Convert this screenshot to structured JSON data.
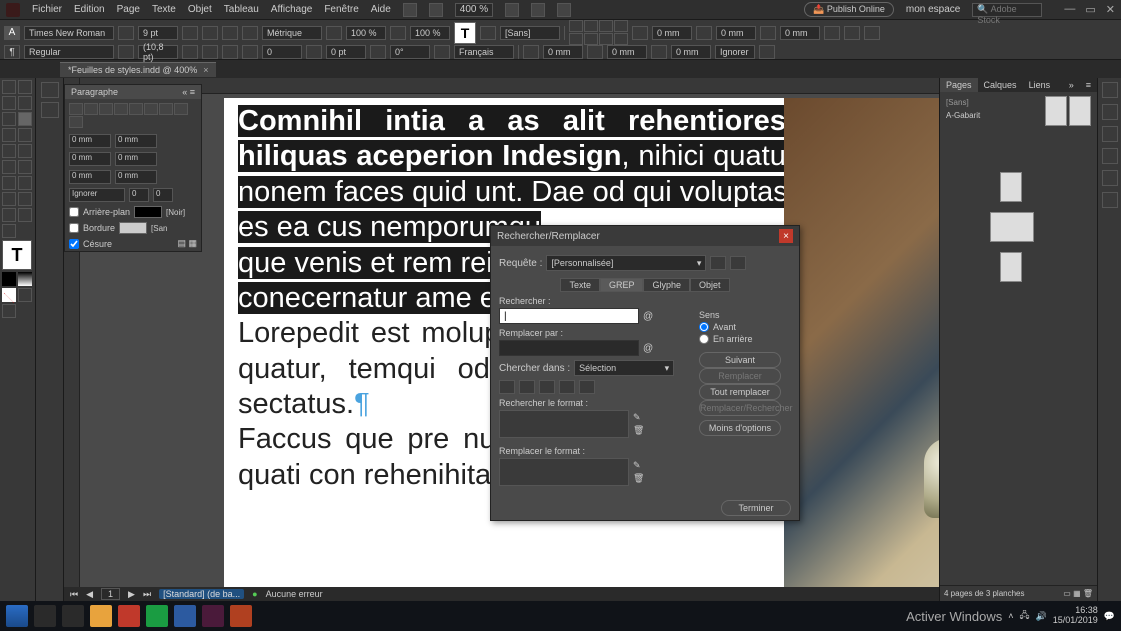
{
  "menu": {
    "items": [
      "Fichier",
      "Edition",
      "Page",
      "Texte",
      "Objet",
      "Tableau",
      "Affichage",
      "Fenêtre",
      "Aide"
    ],
    "zoom": "400 %",
    "publish": "Publish Online",
    "workspace": "mon espace",
    "stock_placeholder": "Adobe Stock"
  },
  "ctrl": {
    "font_family": "Times New Roman",
    "font_size": "9 pt",
    "leading": "(10,8 pt)",
    "tracking": "Métrique",
    "kerning_pct_1": "100 %",
    "kerning_pct_2": "100 %",
    "baseline": "0 pt",
    "skew": "0°",
    "stylegroup": "[Sans]",
    "language": "Français",
    "ignore": "Ignorer",
    "mm_label": "0 mm",
    "regular": "Regular"
  },
  "doc_tab": "*Feuilles de styles.indd @ 400%",
  "paragraph_panel": {
    "title": "Paragraphe",
    "mm": "0 mm",
    "ignore": "Ignorer",
    "arriere_plan": "Arrière-plan",
    "bordure": "Bordure",
    "cesure": "Césure",
    "noir": "[Noir]",
    "sans": "[San"
  },
  "text": {
    "p1a_bold": "Comnihil intia a as alit rehentiores ex­perum hiliquas aceperion Indesign",
    "p1b": ", nihici quatur qui sit ma    nonem faces quid unt. Dae od qui voluptas ad   qu",
    "p1c": "es ea cus nemporumqu",
    "p1d": "que venis et rem      reic",
    "p1e": "conecernatur ame eat.",
    "pilcrow": "¶",
    "p2": "Lorepedit est moluptan tur magnimp osseceper sum quatur, temqui od acia doluptior sumet o deste sectatus.",
    "p3": "Faccus que pre num illacim ut delis milit om­nisquo quati con rehenihitat qui berspe porem"
  },
  "dialog": {
    "title": "Rechercher/Remplacer",
    "requete": "Requête :",
    "requete_val": "[Personnalisée]",
    "tabs": [
      "Texte",
      "GREP",
      "Glyphe",
      "Objet"
    ],
    "active_tab": "GREP",
    "rechercher": "Rechercher :",
    "rechercher_val": "|",
    "remplacer_par": "Remplacer par :",
    "chercher_dans": "Chercher dans :",
    "chercher_dans_val": "Sélection",
    "rechercher_format": "Rechercher le format :",
    "remplacer_format": "Remplacer le format :",
    "sens": "Sens",
    "avant": "Avant",
    "arriere": "En arrière",
    "btn_suivant": "Suivant",
    "btn_remplacer": "Remplacer",
    "btn_tout": "Tout remplacer",
    "btn_remp_rech": "Remplacer/Rechercher",
    "btn_moins": "Moins d'options",
    "btn_terminer": "Terminer"
  },
  "right_panel": {
    "tabs": [
      "Pages",
      "Calques",
      "Liens"
    ],
    "active": "Pages",
    "gabarit": "[Sans]",
    "gabarit2": "A-Gabarit",
    "footer": "4 pages de 3 planches"
  },
  "status": {
    "standard": "[Standard] (de ba...",
    "erreur": "Aucune erreur"
  },
  "taskbar": {
    "watermark": "Activer Windows",
    "time": "16:38",
    "date": "15/01/2019"
  }
}
